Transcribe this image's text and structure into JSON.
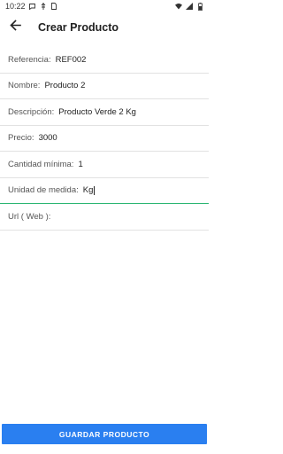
{
  "status_bar": {
    "time": "10:22",
    "icons": [
      "message-icon",
      "usb-icon",
      "sim-icon",
      "wifi-icon",
      "signal-icon",
      "battery-icon"
    ]
  },
  "header": {
    "back_icon": "arrow-left-icon",
    "title": "Crear Producto"
  },
  "form": {
    "fields": [
      {
        "label": "Referencia:",
        "value": "REF002"
      },
      {
        "label": "Nombre:",
        "value": "Producto 2"
      },
      {
        "label": "Descripción:",
        "value": "Producto Verde 2 Kg"
      },
      {
        "label": "Precio:",
        "value": "3000"
      },
      {
        "label": "Cantidad mínima:",
        "value": "1"
      },
      {
        "label": "Unidad de medida:",
        "value": "Kg",
        "focused": true
      },
      {
        "label": "Url ( Web ):",
        "value": ""
      }
    ]
  },
  "footer": {
    "save_label": "GUARDAR PRODUCTO"
  },
  "colors": {
    "accent": "#2a7ff0",
    "focus_underline": "#2bb673"
  }
}
